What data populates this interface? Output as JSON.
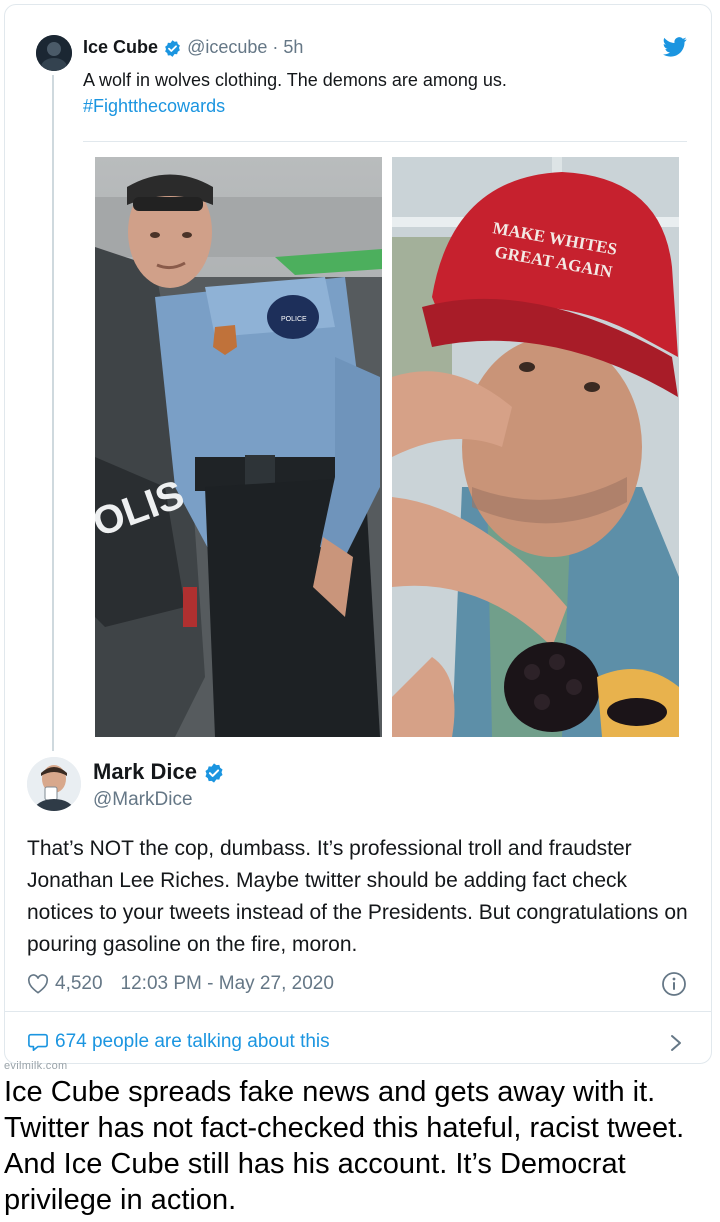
{
  "tweet1": {
    "author_name": "Ice Cube",
    "handle": "@icecube",
    "separator": "·",
    "time": "5h",
    "text": "A wolf in wolves clothing. The demons are among us.",
    "hashtag": "#Fightthecowards"
  },
  "photos": {
    "left": {
      "door_text": "OLIS",
      "patch_text": "POLICE"
    },
    "right": {
      "hat_line1": "MAKE WHITES",
      "hat_line2": "GREAT AGAIN"
    }
  },
  "tweet2": {
    "author_name": "Mark Dice",
    "handle": "@MarkDice",
    "text": "That’s NOT the cop, dumbass.  It’s professional troll and fraudster Jonathan Lee Riches.  Maybe twitter should be adding fact check notices to your tweets instead of the Presidents.  But congratulations on pouring gasoline on the fire, moron.",
    "likes": "4,520",
    "timestamp": "12:03 PM - May 27, 2020",
    "talking": "674 people are talking about this"
  },
  "watermark": "evilmilk.com",
  "caption": "Ice Cube spreads fake news and gets away with it.  Twitter has not fact-checked this hateful, racist tweet. And Ice Cube still has his account. It’s Democrat privilege in action.",
  "colors": {
    "twitter_blue": "#1b95e0",
    "muted": "#657786",
    "border": "#e1e8ed",
    "hat_red": "#c6212e"
  },
  "icons": [
    "verified-icon",
    "twitter-bird-icon",
    "heart-icon",
    "info-icon",
    "reply-bubble-icon",
    "chevron-right-icon"
  ]
}
